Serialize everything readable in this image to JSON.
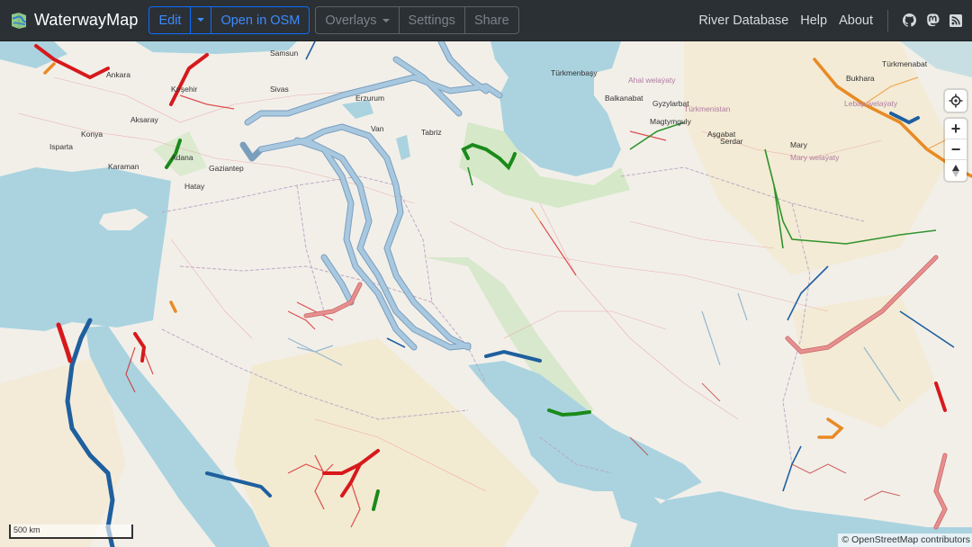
{
  "navbar": {
    "brand": "WaterwayMap",
    "edit_label": "Edit",
    "open_osm_label": "Open in OSM",
    "overlays_label": "Overlays",
    "settings_label": "Settings",
    "share_label": "Share",
    "links": [
      "River Database",
      "Help",
      "About"
    ],
    "icons": [
      "github-icon",
      "mastodon-icon",
      "rss-icon"
    ]
  },
  "map": {
    "scale_label": "500 km",
    "attribution_symbol": "©",
    "attribution_text": "OpenStreetMap contributors",
    "controls": {
      "locate": "locate-icon",
      "zoom_in": "+",
      "zoom_out": "−",
      "compass": "compass-icon"
    },
    "labels": {
      "city": [
        "Ankara",
        "Kırşehir",
        "Aksaray",
        "Konya",
        "Isparta",
        "Karaman",
        "Adana",
        "Gaziantep",
        "Hatay",
        "Samsun",
        "Sivas",
        "Erzurum",
        "Van",
        "Tabriz",
        "Türkmenbaşy",
        "Balkanabat",
        "Gyzylarbat",
        "Magtymguly",
        "Aşgabat",
        "Mary",
        "Bukhara",
        "Türkmenabat",
        "Serdar"
      ],
      "country": [
        "Türkmenistan",
        "Ahal welaýaty",
        "Mary welaýaty",
        "Lebap welaýaty"
      ]
    },
    "colors": {
      "land": "#f2efe9",
      "water": "#aad3df",
      "desert": "#f3e8c8",
      "forest": "#cde6bf",
      "river_blue": "#a8c8e0",
      "river_dark_blue": "#1f5f9e",
      "river_red": "#d7191c",
      "river_pink": "#e58f8f",
      "river_orange": "#f0a04b",
      "river_green": "#1a8a1a"
    }
  }
}
